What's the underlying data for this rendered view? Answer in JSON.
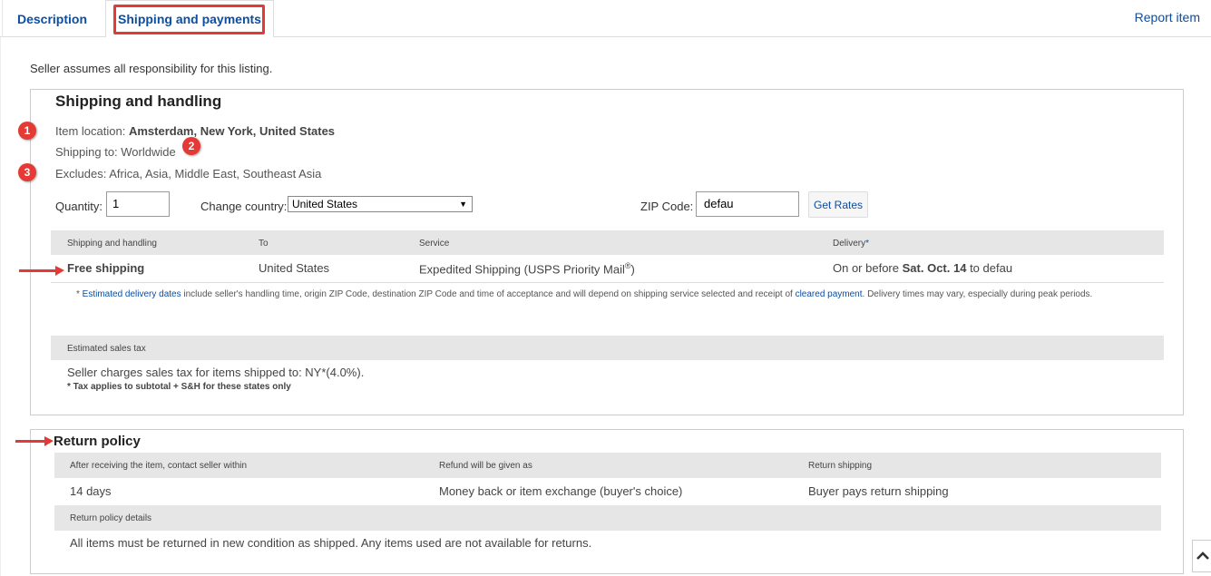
{
  "tabs": {
    "description": "Description",
    "shipping": "Shipping and payments",
    "report": "Report item"
  },
  "responsibility": "Seller assumes all responsibility for this listing.",
  "shipping": {
    "heading": "Shipping and handling",
    "location_label": "Item location:",
    "location_value": "Amsterdam, New York, United States",
    "shipping_to": "Shipping to: Worldwide",
    "excludes": "Excludes: Africa, Asia, Middle East, Southeast Asia",
    "quantity_label": "Quantity:",
    "quantity_value": "1",
    "country_label": "Change country:",
    "country_value": "United States",
    "zip_label": "ZIP Code:",
    "zip_value": "defau",
    "get_rates": "Get Rates",
    "table_headers": {
      "handling": "Shipping and handling",
      "to": "To",
      "service": "Service",
      "delivery": "Delivery",
      "delivery_mark": "*"
    },
    "row": {
      "cost": "Free shipping",
      "to": "United States",
      "service": "Expedited Shipping (USPS Priority Mail",
      "service_reg": "®",
      "service_close": ")",
      "delivery_prefix": "On or before",
      "delivery_date": "Sat. Oct. 14",
      "delivery_suffix": "to defau"
    },
    "note_star": "* ",
    "note_link1": "Estimated delivery dates",
    "note_mid": " include seller's handling time, origin ZIP Code, destination ZIP Code and time of acceptance and will depend on shipping service selected and receipt of ",
    "note_link2": "cleared payment",
    "note_end": ". Delivery times may vary, especially during peak periods."
  },
  "tax": {
    "header": "Estimated sales tax",
    "line": "Seller charges sales tax for items shipped to: NY*(4.0%).",
    "note": "* Tax applies to subtotal + S&H for these states only"
  },
  "returns": {
    "heading": "Return policy",
    "headers": {
      "contact": "After receiving the item, contact seller within",
      "refund": "Refund will be given as",
      "shipping": "Return shipping"
    },
    "row": {
      "contact": "14 days",
      "refund": "Money back or item exchange (buyer's choice)",
      "shipping": "Buyer pays return shipping"
    },
    "details_header": "Return policy details",
    "details": "All items must be returned in new condition as shipped. Any items used are not available for returns."
  },
  "annotations": {
    "badge1": "1",
    "badge2": "2",
    "badge3": "3"
  },
  "icons": {
    "scroll_top": "chevron-up-icon",
    "select_arrow": "triangle-down-icon"
  },
  "colors": {
    "link": "#0b4ea2",
    "annotation": "#e53935",
    "table_header_bg": "#e6e6e6"
  }
}
